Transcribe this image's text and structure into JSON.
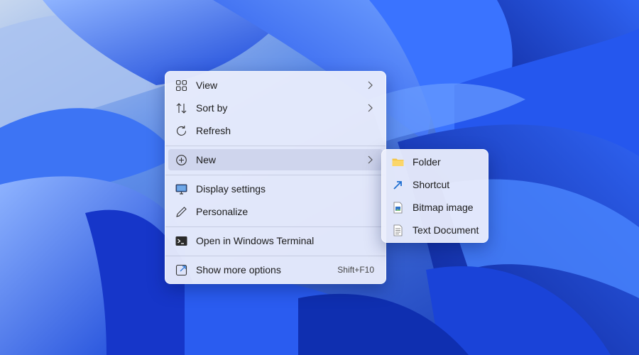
{
  "context_menu": {
    "items": [
      {
        "label": "View",
        "icon": "view-icon",
        "has_submenu": true
      },
      {
        "label": "Sort by",
        "icon": "sort-icon",
        "has_submenu": true
      },
      {
        "label": "Refresh",
        "icon": "refresh-icon",
        "has_submenu": false
      },
      {
        "label": "New",
        "icon": "new-icon",
        "has_submenu": true,
        "hovered": true
      },
      {
        "label": "Display settings",
        "icon": "display-settings-icon",
        "has_submenu": false
      },
      {
        "label": "Personalize",
        "icon": "personalize-icon",
        "has_submenu": false
      },
      {
        "label": "Open in Windows Terminal",
        "icon": "terminal-icon",
        "has_submenu": false
      },
      {
        "label": "Show more options",
        "icon": "show-more-icon",
        "shortcut": "Shift+F10"
      }
    ]
  },
  "new_submenu": {
    "items": [
      {
        "label": "Folder",
        "icon": "folder-icon"
      },
      {
        "label": "Shortcut",
        "icon": "shortcut-icon"
      },
      {
        "label": "Bitmap image",
        "icon": "bitmap-image-icon"
      },
      {
        "label": "Text Document",
        "icon": "text-document-icon"
      }
    ]
  },
  "colors": {
    "wallpaper_base": "#1d4fd8",
    "menu_background": "#ebeefc",
    "hover_background": "#c8cfe8",
    "folder_icon": "#f5c542",
    "shortcut_arrow": "#1f6fd1"
  }
}
